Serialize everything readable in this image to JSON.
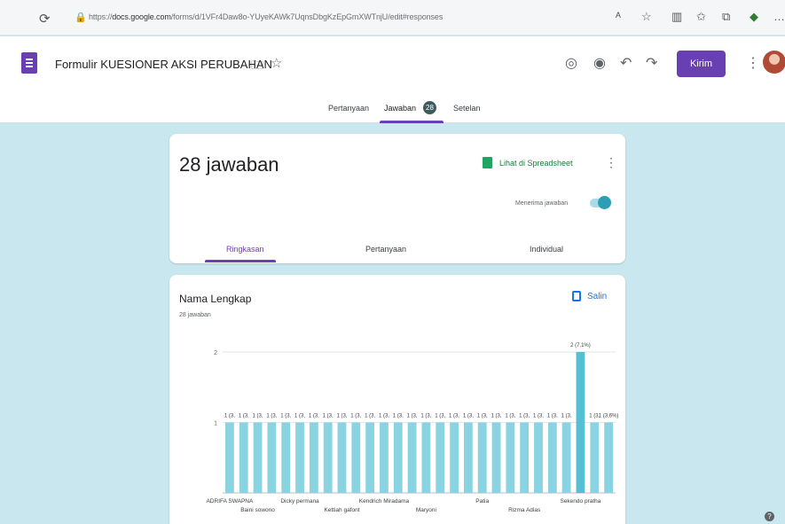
{
  "browser": {
    "url_prefix": "https://",
    "url_domain": "docs.google.com",
    "url_rest": "/forms/d/1VFr4Daw8o-YUyeKAWk7UqnsDbgKzEpGmXWTnjU/edit#responses",
    "reload_glyph": "⟳",
    "icons": [
      "read-aloud-icon",
      "favorite-icon",
      "split-screen-icon",
      "favorites-icon",
      "collections-icon",
      "extension-icon",
      "more-icon"
    ]
  },
  "header": {
    "title": "Formulir KUESIONER AKSI PERUBAHAN",
    "send_label": "Kirim",
    "tabs": [
      {
        "label": "Pertanyaan"
      },
      {
        "label": "Jawaban",
        "badge": "28"
      },
      {
        "label": "Setelan"
      }
    ]
  },
  "summary_card": {
    "response_count": "28 jawaban",
    "sheet_link": "Lihat di Spreadsheet",
    "accept_label": "Menerima jawaban",
    "accept_on": true,
    "subtabs": [
      "Ringkasan",
      "Pertanyaan",
      "Individual"
    ]
  },
  "question_card": {
    "title": "Nama Lengkap",
    "count": "28 jawaban",
    "copy_label": "Salin"
  },
  "colors": {
    "accent": "#6b3fb4",
    "bar": "#8ad3e1",
    "bar_highlight": "#55c0d4",
    "background": "#c9e7ef"
  },
  "chart_data": {
    "type": "bar",
    "title": "",
    "ylim": [
      0,
      2
    ],
    "yticks": [
      1,
      2
    ],
    "values": [
      1,
      1,
      1,
      1,
      1,
      1,
      1,
      1,
      1,
      1,
      1,
      1,
      1,
      1,
      1,
      1,
      1,
      1,
      1,
      1,
      1,
      1,
      1,
      1,
      1,
      2,
      1,
      1
    ],
    "value_labels": [
      "1 (3,",
      "1 (3,",
      "1 (3,",
      "1 (3,",
      "1 (3,",
      "1 (3,",
      "1 (3,",
      "1 (3,",
      "1 (3,",
      "1 (3,",
      "1 (3,",
      "1 (3,",
      "1 (3,",
      "1 (3,",
      "1 (3,",
      "1 (3,",
      "1 (3,",
      "1 (3,",
      "1 (3,",
      "1 (3,",
      "1 (3,",
      "1 (3,",
      "1 (3,",
      "1 (3,",
      "1 (3,",
      "2 (7,1%)",
      "1 (3,",
      "1 (3,6%)"
    ],
    "highlight_index": 25,
    "visible_xlabels_row1": [
      "ADRIFA SWAPNA",
      "Dicky permana",
      "Kendrich Miradama",
      "Patia",
      "Sekendo pratha"
    ],
    "visible_xlabels_row2": [
      "Baini sowono",
      "Kettiah gafont",
      "Maryoni",
      "Rizma Adias"
    ]
  }
}
